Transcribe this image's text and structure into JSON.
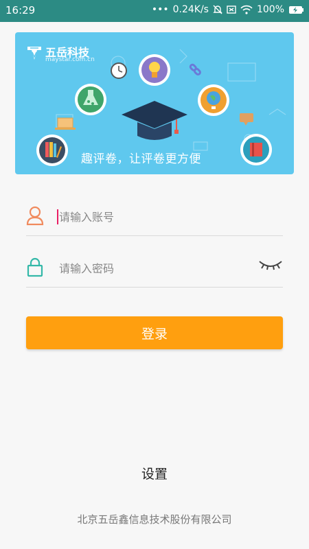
{
  "statusbar": {
    "time": "16:29",
    "network_speed": "0.24K/s",
    "battery": "100%"
  },
  "banner": {
    "logo_name": "五岳科技",
    "logo_sub": "maystar.com.cn",
    "slogan": "趣评卷，让评卷更方便"
  },
  "login": {
    "account_placeholder": "请输入账号",
    "password_placeholder": "请输入密码",
    "submit_label": "登录"
  },
  "settings_label": "设置",
  "company": "北京五岳鑫信息技术股份有限公司",
  "colors": {
    "statusbar": "#2c8b84",
    "banner": "#5fc8ee",
    "accent": "#ff9f0f",
    "user_icon": "#f08a5d",
    "lock_icon": "#34b8a8"
  }
}
